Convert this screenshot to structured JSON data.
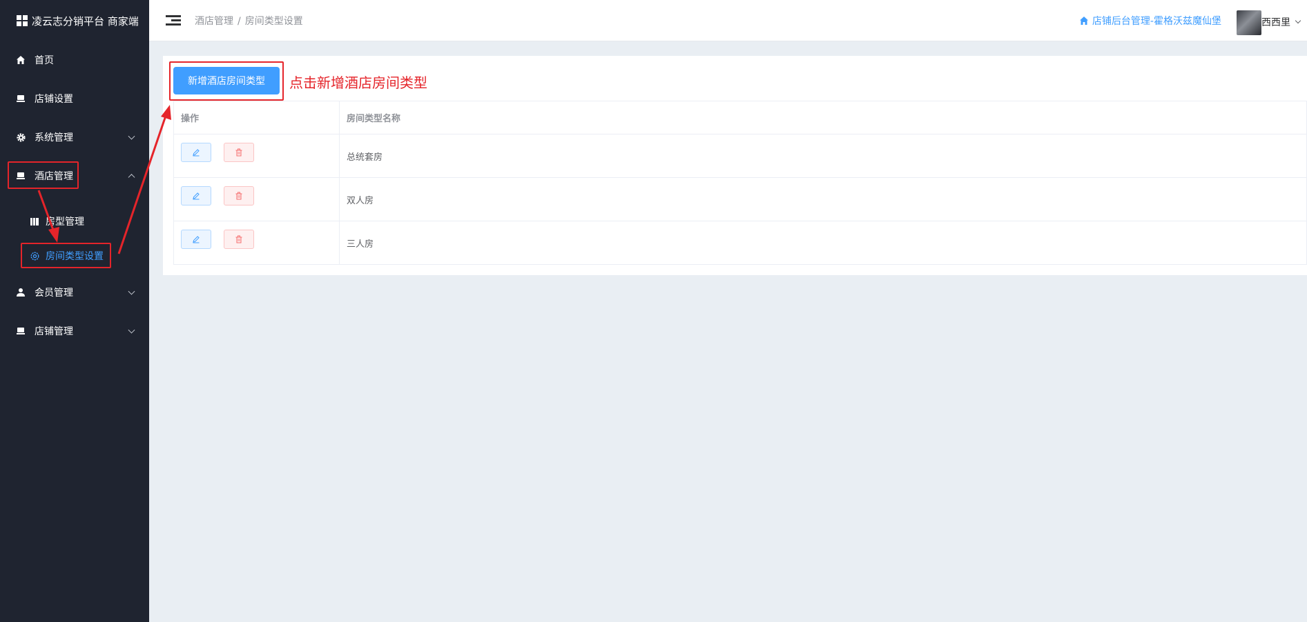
{
  "app": {
    "title": "凌云志分销平台 商家端"
  },
  "sidebar": {
    "items": [
      {
        "label": "首页",
        "icon": "home-icon"
      },
      {
        "label": "店铺设置",
        "icon": "shop-icon"
      },
      {
        "label": "系统管理",
        "icon": "gear-icon",
        "expandable": true
      },
      {
        "label": "酒店管理",
        "icon": "shop-icon",
        "expandable": true,
        "expanded": true
      },
      {
        "label": "会员管理",
        "icon": "user-icon",
        "expandable": true
      },
      {
        "label": "店铺管理",
        "icon": "shop-icon",
        "expandable": true
      }
    ],
    "subitems": [
      {
        "label": "房型管理",
        "icon": "building-icon"
      },
      {
        "label": "房间类型设置",
        "icon": "gear-icon",
        "active": true
      }
    ]
  },
  "header": {
    "breadcrumb": [
      "酒店管理",
      "房间类型设置"
    ],
    "breadcrumb_sep": "/",
    "shop_link": "店铺后台管理-霍格沃兹魔仙堡",
    "user": "西西里"
  },
  "main": {
    "add_button": "新增酒店房间类型",
    "annotation": "点击新增酒店房间类型",
    "table": {
      "columns": [
        "操作",
        "房间类型名称"
      ],
      "rows": [
        {
          "name": "总统套房"
        },
        {
          "name": "双人房"
        },
        {
          "name": "三人房"
        }
      ]
    }
  },
  "colors": {
    "primary": "#409eff",
    "sidebar_bg": "#1f2430",
    "annotation_red": "#e5242a",
    "danger": "#f56c6c"
  }
}
